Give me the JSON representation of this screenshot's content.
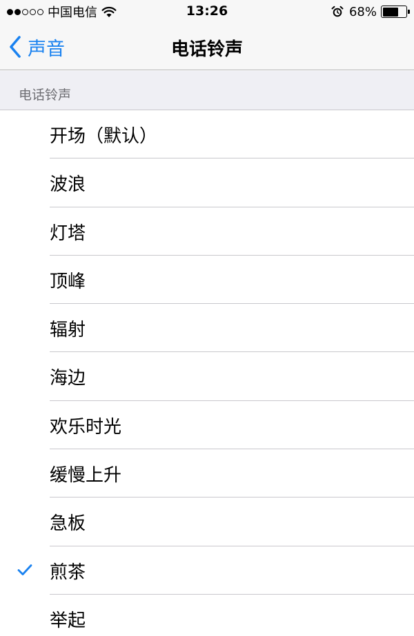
{
  "status_bar": {
    "carrier": "中国电信",
    "time": "13:26",
    "battery": "68%",
    "battery_level": 0.68,
    "signal_strength": 2,
    "signal_total": 5
  },
  "nav": {
    "back_label": "声音",
    "title": "电话铃声"
  },
  "section": {
    "header": "电话铃声"
  },
  "ringtones": [
    {
      "label": "开场（默认）",
      "selected": false
    },
    {
      "label": "波浪",
      "selected": false
    },
    {
      "label": "灯塔",
      "selected": false
    },
    {
      "label": "顶峰",
      "selected": false
    },
    {
      "label": "辐射",
      "selected": false
    },
    {
      "label": "海边",
      "selected": false
    },
    {
      "label": "欢乐时光",
      "selected": false
    },
    {
      "label": "缓慢上升",
      "selected": false
    },
    {
      "label": "急板",
      "selected": false
    },
    {
      "label": "煎茶",
      "selected": true
    },
    {
      "label": "举起",
      "selected": false
    }
  ],
  "colors": {
    "accent": "#1a82f0",
    "section_bg": "#efeff4",
    "bar_bg": "#f7f7f7",
    "separator": "#c8c7cc",
    "section_text": "#6d6d72"
  },
  "icons": {
    "back": "chevron-left-icon",
    "check": "checkmark-icon",
    "wifi": "wifi-icon",
    "alarm": "alarm-clock-icon",
    "battery": "battery-icon"
  }
}
